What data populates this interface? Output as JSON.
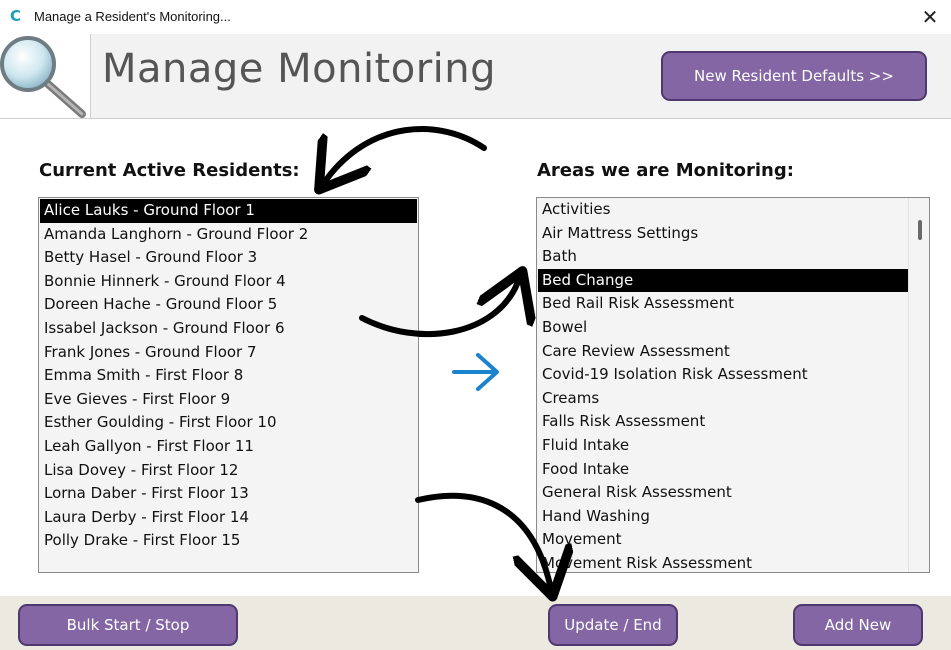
{
  "window": {
    "title": "Manage a Resident's Monitoring...",
    "app_icon_glyph": "C",
    "close_glyph": "✕"
  },
  "header": {
    "title": "Manage Monitoring",
    "defaults_button": "New Resident Defaults >>",
    "logo_icon": "magnifier-icon"
  },
  "residents": {
    "label": "Current Active Residents:",
    "items": [
      "Alice Lauks - Ground Floor 1",
      "Amanda Langhorn - Ground Floor 2",
      "Betty Hasel - Ground Floor 3",
      "Bonnie Hinnerk - Ground Floor 4",
      "Doreen Hache - Ground Floor 5",
      "Issabel Jackson - Ground Floor 6",
      "Frank Jones - Ground Floor 7",
      "Emma Smith - First Floor 8",
      "Eve Gieves - First Floor 9",
      "Esther Goulding - First Floor 10",
      "Leah Gallyon - First Floor 11",
      "Lisa Dovey - First Floor 12",
      "Lorna Daber - First Floor 13",
      "Laura Derby - First Floor 14",
      "Polly Drake - First Floor 15"
    ],
    "selected_index": 0
  },
  "areas": {
    "label": "Areas we are Monitoring:",
    "items": [
      "Activities",
      "Air Mattress Settings",
      "Bath",
      "Bed Change",
      "Bed Rail Risk Assessment",
      "Bowel",
      "Care Review Assessment",
      "Covid-19 Isolation Risk Assessment",
      "Creams",
      "Falls Risk Assessment",
      "Fluid Intake",
      "Food Intake",
      "General Risk Assessment",
      "Hand Washing",
      "Movement",
      "Movement Risk Assessment"
    ],
    "selected_index": 3
  },
  "footer": {
    "bulk_button": "Bulk Start / Stop",
    "update_button": "Update / End",
    "add_button": "Add New"
  },
  "colors": {
    "button_fill": "#8366a3",
    "button_border": "#4f3870",
    "selection": "#000000",
    "accent_arrow": "#1c84cf",
    "footer_bg": "#ebe9e0",
    "header_bg": "#f2f2f2"
  }
}
